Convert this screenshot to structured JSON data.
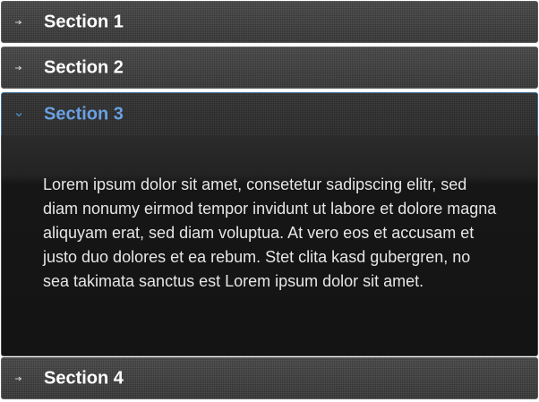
{
  "accordion": {
    "sections": [
      {
        "title": "Section 1",
        "expanded": false,
        "icon": "arrow-right-icon"
      },
      {
        "title": "Section 2",
        "expanded": false,
        "icon": "arrow-right-icon"
      },
      {
        "title": "Section 3",
        "expanded": true,
        "icon": "chevron-down-icon",
        "content": "Lorem ipsum dolor sit amet, consetetur sadipscing elitr, sed diam nonumy eirmod tempor invidunt ut labore et dolore magna aliquyam erat, sed diam voluptua. At vero eos et accusam et justo duo dolores et ea rebum. Stet clita kasd gubergren, no sea takimata sanctus est Lorem ipsum dolor sit amet."
      },
      {
        "title": "Section 4",
        "expanded": false,
        "icon": "arrow-right-icon"
      }
    ]
  },
  "colors": {
    "header_background": "#3a3a3a",
    "header_text": "#ffffff",
    "active_header_text": "#6aa0e4",
    "active_border": "#3d6f98",
    "panel_background": "#141414",
    "panel_text": "#e6e6e6"
  }
}
